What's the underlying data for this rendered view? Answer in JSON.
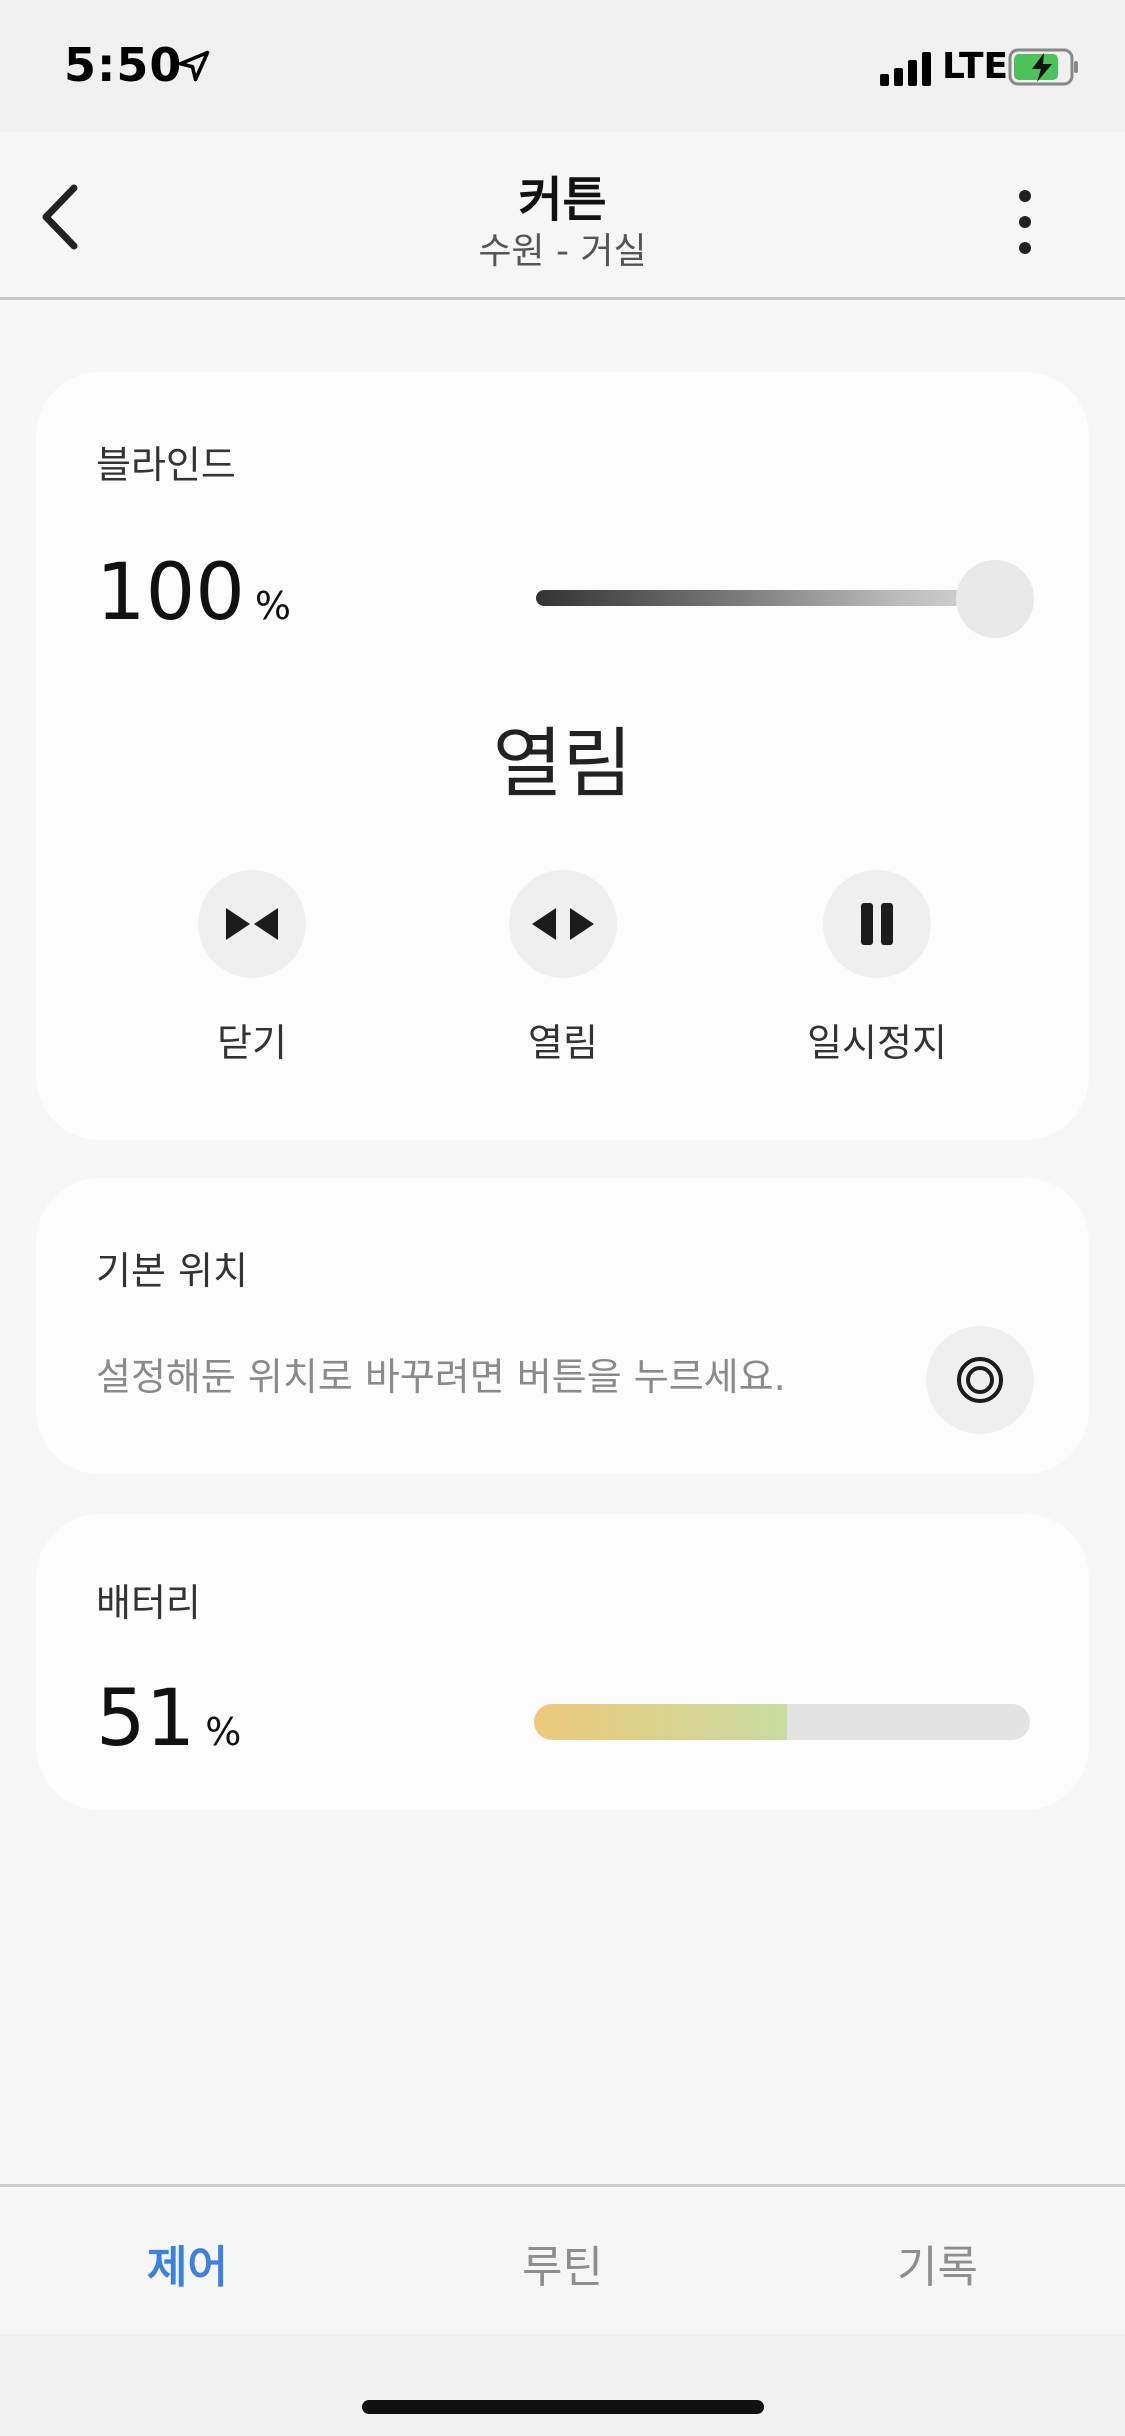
{
  "status_bar": {
    "time": "5:50",
    "network": "LTE"
  },
  "header": {
    "title": "커튼",
    "subtitle": "수원 - 거실"
  },
  "blind": {
    "label": "블라인드",
    "percent_value": "100",
    "percent_unit": "%",
    "slider_level": 1.0,
    "state": "열림",
    "controls": [
      {
        "label": "닫기",
        "icon": "close-curtain-icon"
      },
      {
        "label": "열림",
        "icon": "open-curtain-icon"
      },
      {
        "label": "일시정지",
        "icon": "pause-icon"
      }
    ]
  },
  "preset": {
    "label": "기본 위치",
    "description": "설정해둔 위치로 바꾸려면 버튼을 누르세요.",
    "icon": "target-icon"
  },
  "battery": {
    "label": "배터리",
    "percent_value": "51",
    "percent_unit": "%",
    "level": 0.51
  },
  "tabs": [
    {
      "label": "제어",
      "active": true
    },
    {
      "label": "루틴",
      "active": false
    },
    {
      "label": "기록",
      "active": false
    }
  ],
  "colors": {
    "accent": "#3b82e0",
    "battery_low": "#ecc97a",
    "battery_high": "#c8dba0"
  }
}
